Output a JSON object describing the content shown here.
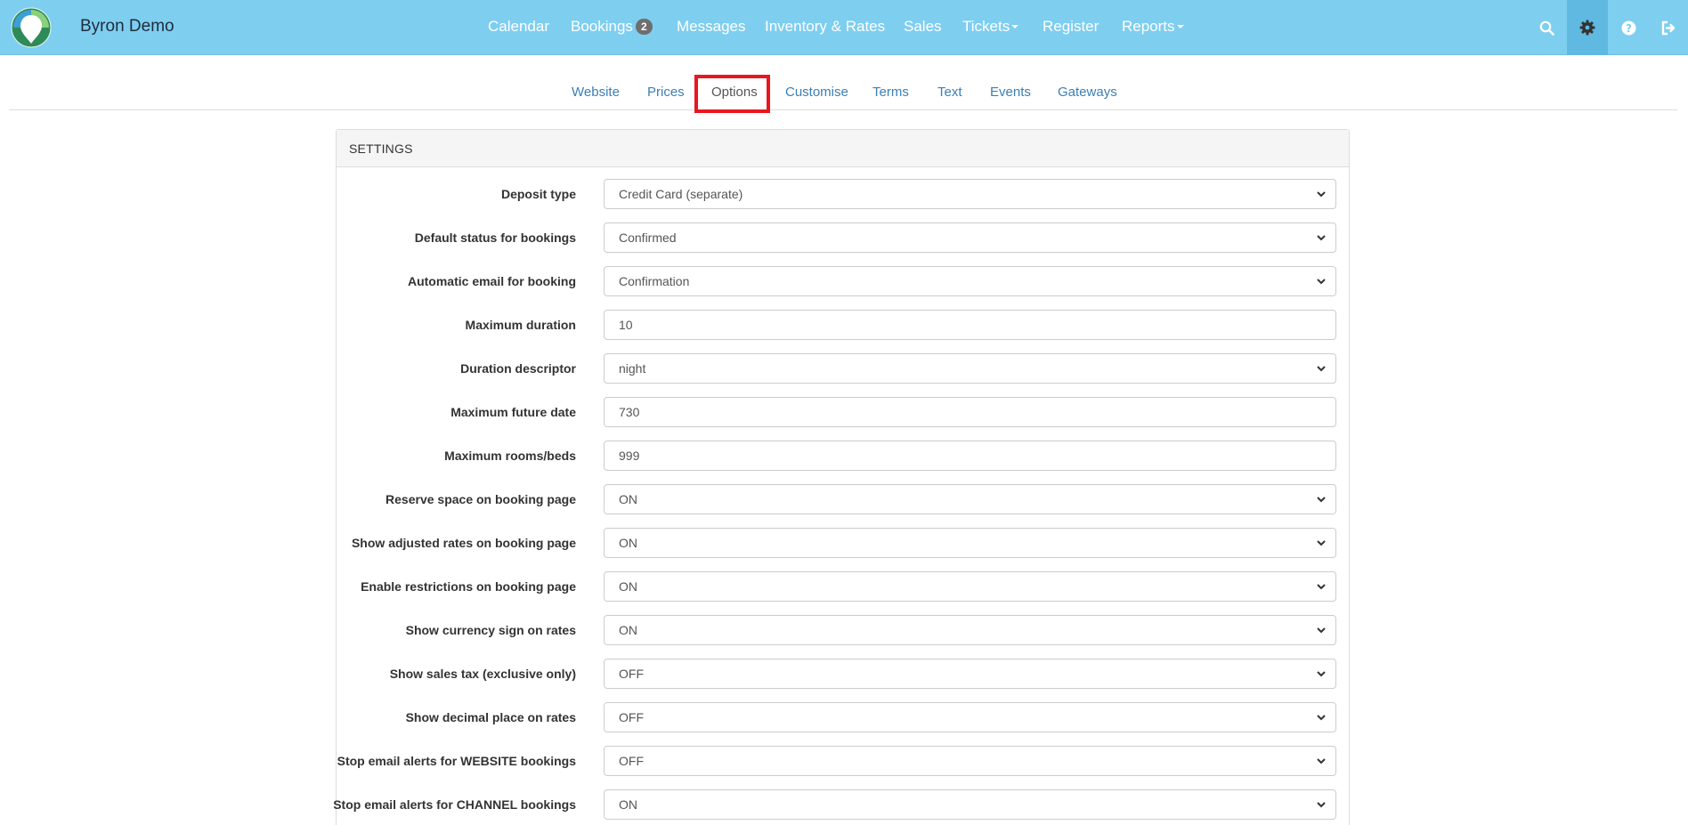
{
  "app": {
    "brand": "Byron Demo"
  },
  "nav": {
    "items": [
      {
        "label": "Calendar"
      },
      {
        "label": "Bookings",
        "badge": "2"
      },
      {
        "label": "Messages"
      },
      {
        "label": "Inventory & Rates"
      },
      {
        "label": "Sales"
      },
      {
        "label": "Tickets",
        "dropdown": true
      },
      {
        "label": "Register"
      },
      {
        "label": "Reports",
        "dropdown": true
      }
    ],
    "icons": [
      "search-icon",
      "gear-icon",
      "help-icon",
      "logout-icon"
    ],
    "active_icon": "gear-icon"
  },
  "subtabs": {
    "items": [
      {
        "label": "Website"
      },
      {
        "label": "Prices"
      },
      {
        "label": "Options"
      },
      {
        "label": "Customise"
      },
      {
        "label": "Terms"
      },
      {
        "label": "Text"
      },
      {
        "label": "Events"
      },
      {
        "label": "Gateways"
      }
    ],
    "active": "Options"
  },
  "settings": {
    "heading": "SETTINGS",
    "rows": [
      {
        "label": "Deposit type",
        "type": "select",
        "value": "Credit Card (separate)"
      },
      {
        "label": "Default status for bookings",
        "type": "select",
        "value": "Confirmed"
      },
      {
        "label": "Automatic email for booking",
        "type": "select",
        "value": "Confirmation"
      },
      {
        "label": "Maximum duration",
        "type": "input",
        "value": "10"
      },
      {
        "label": "Duration descriptor",
        "type": "select",
        "value": "night"
      },
      {
        "label": "Maximum future date",
        "type": "input",
        "value": "730"
      },
      {
        "label": "Maximum rooms/beds",
        "type": "input",
        "value": "999"
      },
      {
        "label": "Reserve space on booking page",
        "type": "select",
        "value": "ON"
      },
      {
        "label": "Show adjusted rates on booking page",
        "type": "select",
        "value": "ON"
      },
      {
        "label": "Enable restrictions on booking page",
        "type": "select",
        "value": "ON"
      },
      {
        "label": "Show currency sign on rates",
        "type": "select",
        "value": "ON"
      },
      {
        "label": "Show sales tax (exclusive only)",
        "type": "select",
        "value": "OFF"
      },
      {
        "label": "Show decimal place on rates",
        "type": "select",
        "value": "OFF"
      },
      {
        "label": "Stop email alerts for WEBSITE bookings",
        "type": "select",
        "value": "OFF"
      },
      {
        "label": "Stop email alerts for CHANNEL bookings",
        "type": "select",
        "value": "ON"
      }
    ]
  },
  "colors": {
    "navbar": "#7ecef0",
    "link": "#3a7fb5",
    "highlight": "#e8171f"
  }
}
